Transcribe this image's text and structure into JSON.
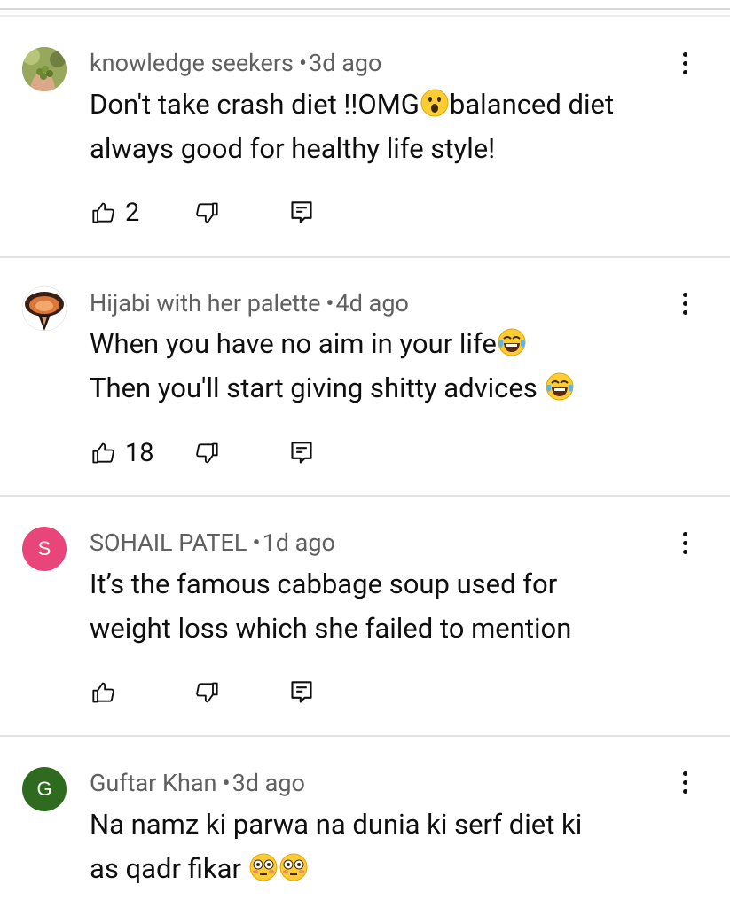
{
  "comments": [
    {
      "author": "knowledge seekers",
      "time": "3d ago",
      "line1": "Don't take crash diet !!OMG",
      "line1_emoji": "astonished-face",
      "line1_tail": "balanced diet",
      "line2": "always good for healthy life style!",
      "likes": "2",
      "avatar_type": "photo-hand-with-grapes"
    },
    {
      "author": "Hijabi with her palette",
      "time": "4d ago",
      "line1": "When you have no aim in your life",
      "line1_emoji": "tears-of-joy",
      "line2": "Then you'll start giving shitty advices ",
      "line2_emoji": "tears-of-joy",
      "likes": "18",
      "avatar_type": "photo-painting"
    },
    {
      "author": "SOHAIL PATEL",
      "time": "1d ago",
      "line1": "It’s the famous cabbage soup used for",
      "line2": "weight loss which she failed to mention",
      "likes": "",
      "avatar_letter": "S",
      "avatar_color": "#e8457a"
    },
    {
      "author": "Guftar Khan",
      "time": "3d ago",
      "line1": "Na namz ki parwa na dunia ki serf diet  ki",
      "line2": "as qadr fikar ",
      "line2_emoji": "flushed-face",
      "likes": "",
      "avatar_letter": "G",
      "avatar_color": "#2e6b1e"
    }
  ],
  "dot_separator": "•",
  "colors": {
    "meta_text": "#606060",
    "body_text": "#0f0f0f",
    "divider": "#e2e2e2",
    "emoji_yellow": "#ffcc33"
  }
}
